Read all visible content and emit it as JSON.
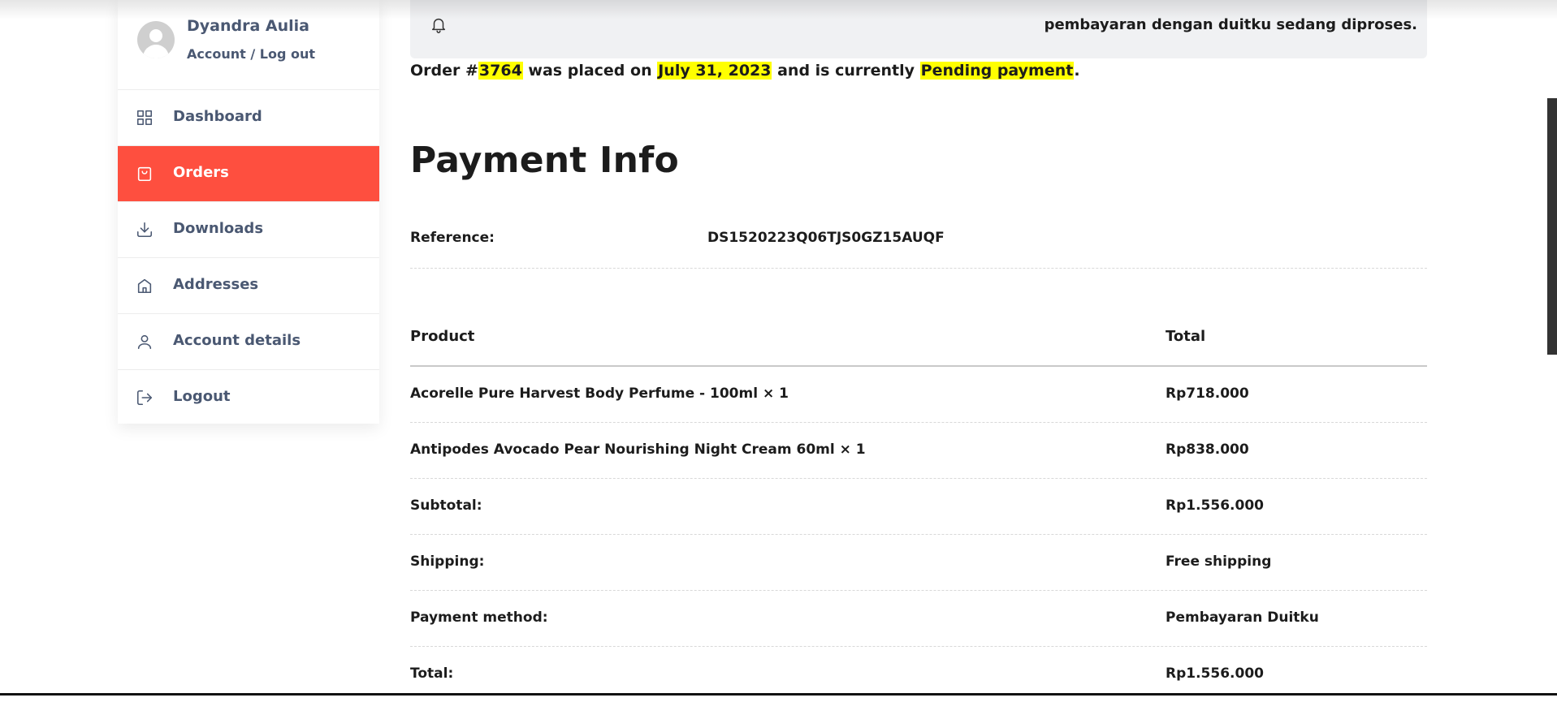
{
  "user": {
    "name": "Dyandra Aulia",
    "account_link": "Account",
    "separator": " / ",
    "logout_link": "Log out"
  },
  "sidebar": {
    "items": [
      {
        "label": "Dashboard",
        "icon": "grid-icon"
      },
      {
        "label": "Orders",
        "icon": "shopping-bag-icon",
        "active": true
      },
      {
        "label": "Downloads",
        "icon": "download-icon"
      },
      {
        "label": "Addresses",
        "icon": "home-icon"
      },
      {
        "label": "Account details",
        "icon": "user-icon"
      },
      {
        "label": "Logout",
        "icon": "logout-icon"
      }
    ]
  },
  "notice": {
    "message": "pembayaran dengan duitku sedang diproses.",
    "icon": "bell-icon"
  },
  "order": {
    "prefix": "Order #",
    "number": "3764",
    "placed_text": " was placed on ",
    "date": "July 31, 2023",
    "status_text": " and is currently ",
    "status": "Pending payment",
    "suffix": "."
  },
  "payment_info": {
    "title": "Payment Info",
    "reference_label": "Reference:",
    "reference_value": "DS1520223Q06TJS0GZ15AUQF"
  },
  "table": {
    "headers": [
      "Product",
      "Total"
    ],
    "rows": [
      [
        "Acorelle Pure Harvest Body Perfume - 100ml × 1",
        "Rp718.000"
      ],
      [
        "Antipodes Avocado Pear Nourishing Night Cream 60ml × 1",
        "Rp838.000"
      ],
      [
        "Subtotal:",
        "Rp1.556.000"
      ],
      [
        "Shipping:",
        "Free shipping"
      ],
      [
        "Payment method:",
        "Pembayaran Duitku"
      ],
      [
        "Total:",
        "Rp1.556.000"
      ]
    ]
  },
  "colors": {
    "accent": "#fe4f3f",
    "highlight": "#ffff00",
    "nav_text": "#4a5872",
    "notice_bg": "#f0f1f3"
  }
}
